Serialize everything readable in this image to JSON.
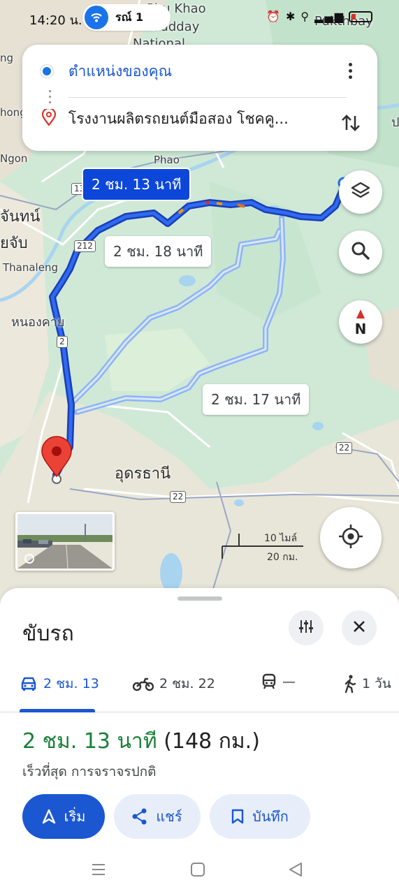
{
  "status_bar": {
    "time": "14:20 น.",
    "hotspot_text": "รณ์ 1",
    "icons": [
      "alarm-icon",
      "bluetooth-icon",
      "location-icon",
      "wifi-calling-icon",
      "signal-icon",
      "battery-low-icon"
    ]
  },
  "directions": {
    "origin": "ตำแหน่งของคุณ",
    "destination": "โรงงานผลิตรถยนต์มือสอง โชคคู..."
  },
  "map": {
    "labels": {
      "khao": "Phu Khao",
      "national": "Sudday",
      "national2": "National",
      "phao": "Phao",
      "ngon": "Ngon",
      "ng": "ng",
      "hong": "hong",
      "vientiane1": "จันทน์",
      "vientiane2": "ยจับ",
      "thanaleng": "Thanaleng",
      "nongkhai": "หนองคาย",
      "udon": "อุดรธานี",
      "phukthbay": "Pukthbay",
      "edge": "ป"
    },
    "shields": [
      "13",
      "212",
      "2",
      "22",
      "22"
    ],
    "routes": [
      {
        "label": "2 ชม. 13 นาที",
        "selected": true
      },
      {
        "label": "2 ชม. 18 นาที",
        "selected": false
      },
      {
        "label": "2 ชม. 17 นาที",
        "selected": false
      }
    ],
    "scale": {
      "miles": "10 ไมล์",
      "km": "20 กม."
    },
    "compass_letter": "N"
  },
  "sheet": {
    "title": "ขับรถ",
    "modes": [
      {
        "id": "drive",
        "icon": "car-icon",
        "label": "2 ชม. 13"
      },
      {
        "id": "motorcycle",
        "icon": "motorcycle-icon",
        "label": "2 ชม. 22"
      },
      {
        "id": "transit",
        "icon": "train-icon",
        "label": "—"
      },
      {
        "id": "walk",
        "icon": "walk-icon",
        "label": "1 วัน"
      }
    ],
    "duration": "2 ชม. 13 นาที",
    "distance": "(148 กม.)",
    "description": "เร็วที่สุด การจราจรปกติ",
    "buttons": {
      "start": "เริ่ม",
      "share": "แชร์",
      "save": "บันทึก"
    }
  },
  "colors": {
    "primary": "#1a57d1",
    "route_selected": "#0d47d9",
    "route_alt": "#8fb4f5",
    "duration_green": "#188038",
    "map_green": "#cfe9d6"
  }
}
